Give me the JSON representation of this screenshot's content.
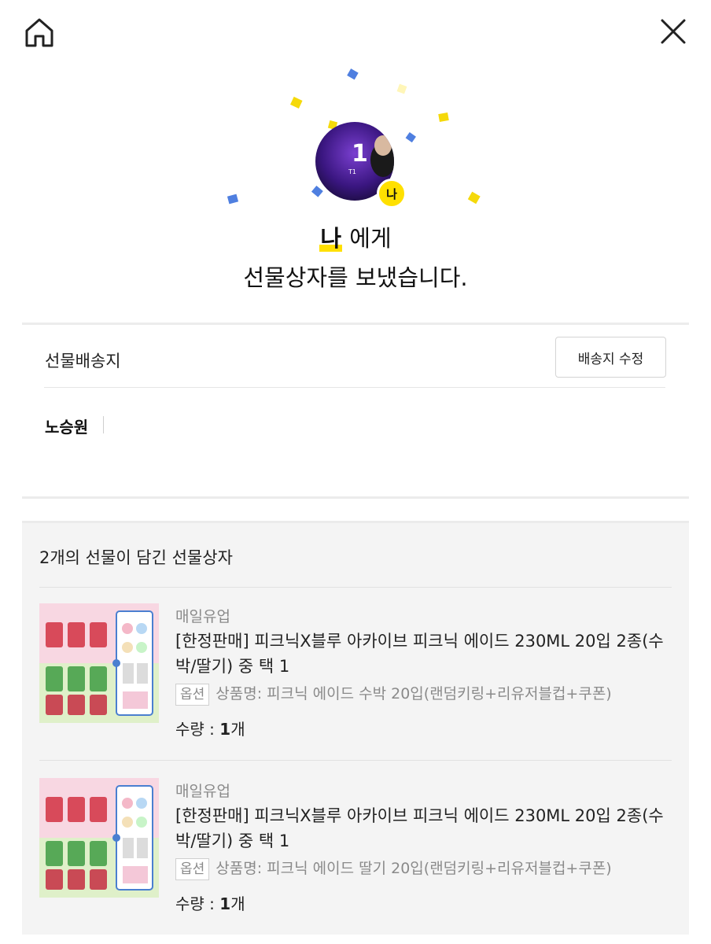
{
  "topbar": {
    "home_icon": "home-icon",
    "close_icon": "close-icon"
  },
  "hero": {
    "recipient": "나",
    "recipient_suffix": " 에게",
    "message": "선물상자를 보냈습니다.",
    "me_badge": "나",
    "avatar_text": "1",
    "avatar_caption": "T1"
  },
  "shipping": {
    "title": "선물배송지",
    "edit_label": "배송지 수정",
    "name": "노승원"
  },
  "giftbox": {
    "title": "2개의 선물이 담긴 선물상자",
    "items": [
      {
        "brand": "매일유업",
        "name": "[한정판매] 피크닉X블루 아카이브 피크닉 에이드 230ML 20입 2종(수박/딸기) 중 택 1",
        "option_tag": "옵션",
        "option": "상품명: 피크닉 에이드 수박 20입(랜덤키링+리유저블컵+쿠폰)",
        "qty_label": "수량 : ",
        "qty_value": "1",
        "qty_unit": "개"
      },
      {
        "brand": "매일유업",
        "name": "[한정판매] 피크닉X블루 아카이브 피크닉 에이드 230ML 20입 2종(수박/딸기) 중 택 1",
        "option_tag": "옵션",
        "option": "상품명: 피크닉 에이드 딸기 20입(랜덤키링+리유저블컵+쿠폰)",
        "qty_label": "수량 : ",
        "qty_value": "1",
        "qty_unit": "개"
      }
    ]
  },
  "colors": {
    "accent": "#ffe000",
    "confetti_blue": "#4f7fe0",
    "confetti_yellow": "#f5d90a"
  }
}
